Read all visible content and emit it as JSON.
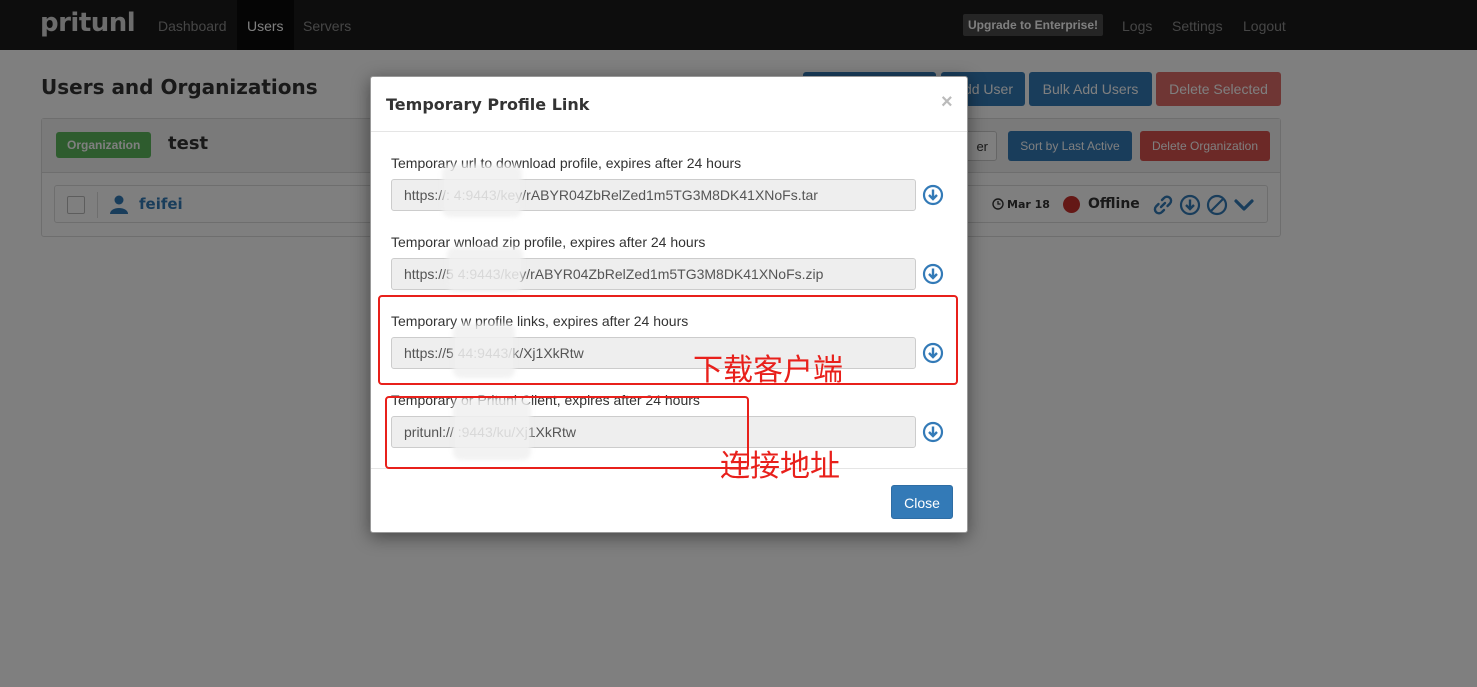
{
  "navbar": {
    "brand": "pritunl",
    "links": [
      "Dashboard",
      "Users",
      "Servers"
    ],
    "upgrade": "Upgrade to Enterprise!",
    "right_links": [
      "Logs",
      "Settings",
      "Logout"
    ]
  },
  "page": {
    "title": "Users and Organizations",
    "buttons": {
      "add_user": "dd User",
      "bulk_add": "Bulk Add Users",
      "delete_selected": "Delete Selected"
    }
  },
  "organization": {
    "label": "Organization",
    "name": "test",
    "add_user_ghost": "er",
    "sort_button": "Sort by Last Active",
    "delete_button": "Delete Organization"
  },
  "user_row": {
    "name": "feifei",
    "last_active": "Mar 18",
    "status": "Offline"
  },
  "modal": {
    "title": "Temporary Profile Link",
    "close_x": "×",
    "fields": [
      {
        "label": "Temporary url to download profile, expires after 24 hours",
        "value": "https://:          4:9443/key/rABYR04ZbRelZed1m5TG3M8DK41XNoFs.tar"
      },
      {
        "label": "Temporar              wnload zip profile, expires after 24 hours",
        "value": "https://5          4:9443/key/rABYR04ZbRelZed1m5TG3M8DK41XNoFs.zip"
      },
      {
        "label": "Temporary              w profile links, expires after 24 hours",
        "value": "https://5          44:9443/k/Xj1XkRtw"
      },
      {
        "label": "Temporary              or Pritunl Client, expires after 24 hours",
        "value": "pritunl://               :9443/ku/Xj1XkRtw"
      }
    ],
    "close_button": "Close"
  },
  "annotations": {
    "download_client": "下载客户端",
    "connect_address": "连接地址"
  },
  "colors": {
    "primary": "#337ab7",
    "danger": "#d9534f",
    "success": "#5cb85c",
    "annotation": "#e8201b"
  }
}
